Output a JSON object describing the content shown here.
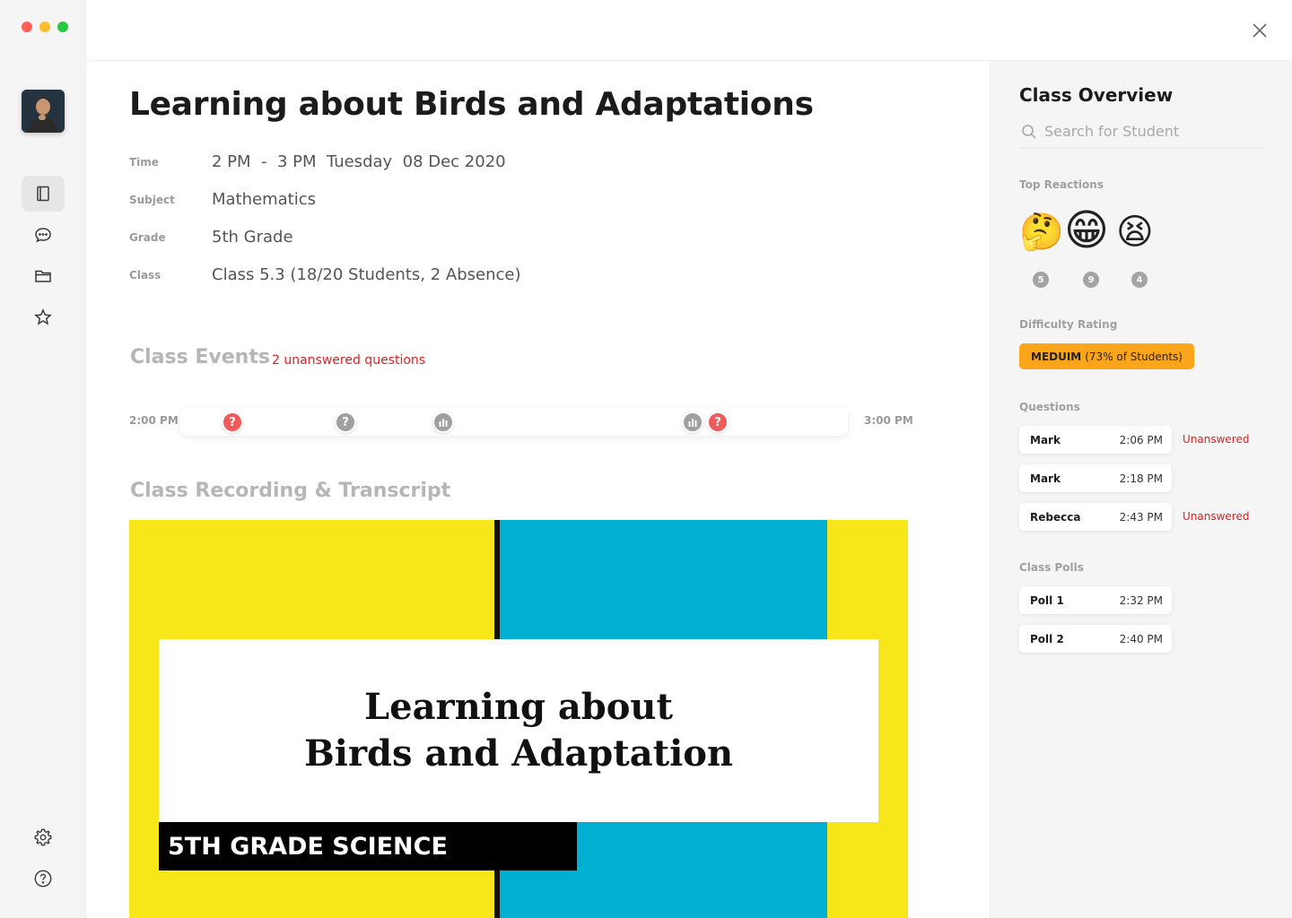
{
  "window": {
    "traffic_colors": [
      "#ff5f57",
      "#febc2e",
      "#28c840"
    ]
  },
  "sidebar": {
    "items": [
      {
        "name": "book-icon",
        "active": true
      },
      {
        "name": "chat-icon",
        "active": false
      },
      {
        "name": "folder-icon",
        "active": false
      },
      {
        "name": "star-icon",
        "active": false
      }
    ],
    "bottom": [
      "gear-icon",
      "help-icon"
    ]
  },
  "lesson": {
    "title": "Learning about Birds and Adaptations",
    "details": [
      {
        "label": "Time",
        "value": "2 PM  -  3 PM  Tuesday  08 Dec 2020"
      },
      {
        "label": "Subject",
        "value": "Mathematics"
      },
      {
        "label": "Grade",
        "value": "5th Grade"
      },
      {
        "label": "Class",
        "value": "Class 5.3 (18/20 Students, 2 Absence)"
      }
    ]
  },
  "events": {
    "title": "Class Events",
    "note": "2 unanswered questions",
    "start_label": "2:00 PM",
    "end_label": "3:00 PM",
    "markers": [
      {
        "type": "question",
        "state": "unanswered",
        "glyph": "?"
      },
      {
        "type": "question",
        "state": "answered",
        "glyph": "?"
      },
      {
        "type": "poll",
        "glyph": "poll-icon"
      },
      {
        "type": "poll",
        "glyph": "poll-icon"
      },
      {
        "type": "question",
        "state": "unanswered",
        "glyph": "?"
      }
    ]
  },
  "recording": {
    "title": "Class Recording & Transcript",
    "slide_line1": "Learning about",
    "slide_line2": "Birds and Adaptation",
    "slide_band": "5TH GRADE SCIENCE"
  },
  "overview": {
    "title": "Class Overview",
    "search_placeholder": "Search for Student",
    "reactions_label": "Top Reactions",
    "reactions": [
      {
        "emoji": "🤔",
        "count": "5"
      },
      {
        "emoji": "😁",
        "count": "9"
      },
      {
        "emoji": "😫",
        "count": "4"
      }
    ],
    "difficulty_label": "Difficulty Rating",
    "difficulty_level": "MEDUIM",
    "difficulty_detail": "(73% of Students)",
    "questions_label": "Questions",
    "questions": [
      {
        "name": "Mark",
        "time": "2:06 PM",
        "status": "Unanswered"
      },
      {
        "name": "Mark",
        "time": "2:18 PM",
        "status": ""
      },
      {
        "name": "Rebecca",
        "time": "2:43 PM",
        "status": "Unanswered"
      }
    ],
    "polls_label": "Class Polls",
    "polls": [
      {
        "name": "Poll 1",
        "time": "2:32 PM"
      },
      {
        "name": "Poll 2",
        "time": "2:40 PM"
      }
    ]
  }
}
